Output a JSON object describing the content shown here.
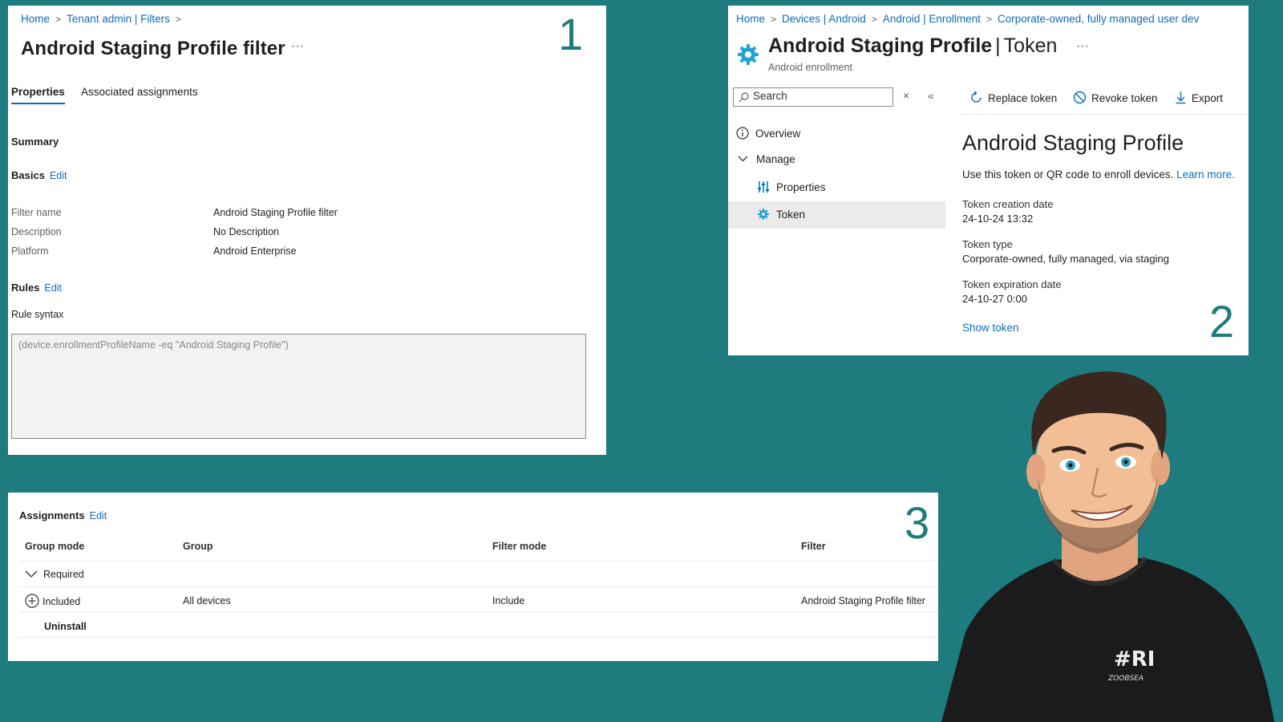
{
  "panel1": {
    "breadcrumb": [
      "Home",
      "Tenant admin | Filters"
    ],
    "title": "Android Staging Profile filter",
    "more": "···",
    "number": "1",
    "tabs": [
      "Properties",
      "Associated assignments"
    ],
    "summary_label": "Summary",
    "basics_label": "Basics",
    "edit_label": "Edit",
    "fields": [
      {
        "label": "Filter name",
        "value": "Android Staging Profile filter"
      },
      {
        "label": "Description",
        "value": "No Description"
      },
      {
        "label": "Platform",
        "value": "Android Enterprise"
      }
    ],
    "rules_label": "Rules",
    "rule_syntax_label": "Rule syntax",
    "rule_text": "(device.enrollmentProfileName -eq \"Android Staging Profile\")"
  },
  "panel2": {
    "breadcrumb": [
      "Home",
      "Devices | Android",
      "Android | Enrollment",
      "Corporate-owned, fully managed user dev"
    ],
    "title_main": "Android Staging Profile",
    "title_bar": "|",
    "title_sub": "Token",
    "more": "···",
    "subtitle": "Android enrollment",
    "search_placeholder": "Search",
    "close_glyph": "×",
    "collapse_glyph": "«",
    "nav": {
      "overview": "Overview",
      "manage": "Manage",
      "properties": "Properties",
      "token": "Token"
    },
    "toolbar": {
      "replace": "Replace token",
      "revoke": "Revoke token",
      "export": "Export"
    },
    "heading": "Android Staging Profile",
    "description": "Use this token or QR code to enroll devices.",
    "learn_more": "Learn more.",
    "fields": [
      {
        "label": "Token creation date",
        "value": "24-10-24 13:32"
      },
      {
        "label": "Token type",
        "value": "Corporate-owned, fully managed, via staging"
      },
      {
        "label": "Token expiration date",
        "value": "24-10-27 0:00"
      }
    ],
    "show_token": "Show token",
    "number": "2",
    "accent": "#1ea2d9"
  },
  "panel3": {
    "title": "Assignments",
    "edit_label": "Edit",
    "number": "3",
    "columns": [
      "Group mode",
      "Group",
      "Filter mode",
      "Filter"
    ],
    "required_label": "Required",
    "included_row": {
      "mode": "Included",
      "group": "All devices",
      "filter_mode": "Include",
      "filter": "Android Staging Profile filter"
    },
    "uninstall_label": "Uninstall"
  },
  "avatar": {
    "shirt_logo": "#RI",
    "shirt_text": "ZOOBSEA"
  },
  "colors": {
    "background": "#1e7b7e",
    "link": "#0f6cbd"
  }
}
